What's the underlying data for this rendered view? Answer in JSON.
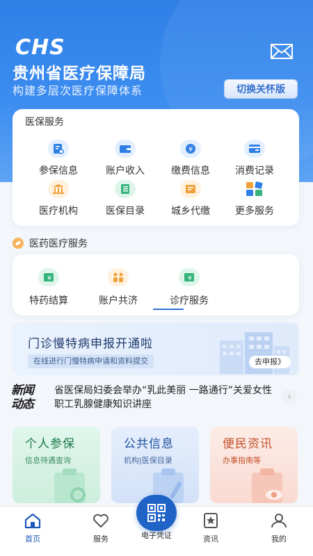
{
  "header": {
    "logo_text": "CHS",
    "org_name": "贵州省医疗保障局",
    "slogan": "构建多层次医疗保障体系",
    "care_mode_button": "切换关怀版",
    "mail_icon": "envelope-icon"
  },
  "services": {
    "title": "医保服务",
    "items": [
      {
        "label": "参保信息",
        "icon": "insurance-doc-icon",
        "color": "#2f7fe6"
      },
      {
        "label": "账户收入",
        "icon": "wallet-icon",
        "color": "#2f7fe6"
      },
      {
        "label": "缴费信息",
        "icon": "yuan-coin-icon",
        "color": "#2f7fe6"
      },
      {
        "label": "消费记录",
        "icon": "card-record-icon",
        "color": "#2f7fe6"
      },
      {
        "label": "医疗机构",
        "icon": "building-icon",
        "color": "#f0a13a"
      },
      {
        "label": "医保目录",
        "icon": "list-doc-icon",
        "color": "#34b37a"
      },
      {
        "label": "城乡代缴",
        "icon": "pay-doc-icon",
        "color": "#f0a13a"
      },
      {
        "label": "更多服务",
        "icon": "grid-apps-icon",
        "color": "#2f7fe6"
      }
    ]
  },
  "medical": {
    "title": "医药医疗服务",
    "items": [
      {
        "label": "特药结算",
        "icon": "yuan-bill-icon"
      },
      {
        "label": "账户共济",
        "icon": "family-share-icon"
      },
      {
        "label": "诊疗服务",
        "icon": "yuan-bill-icon"
      }
    ]
  },
  "banner": {
    "title": "门诊慢特病申报开通啦",
    "subtitle": "在线进行门慢特病申请和资料提交",
    "action": "去申报》"
  },
  "news": {
    "badge_line1": "新闻",
    "badge_line2": "动态",
    "headline": "省医保局妇委会举办“乳此美丽 一路通行”关爱女性职工乳腺健康知识讲座",
    "arrow": "›"
  },
  "tiles": [
    {
      "title": "个人参保",
      "subtitle": "信息待遇查询"
    },
    {
      "title": "公共信息",
      "subtitle": "机构|医保目录"
    },
    {
      "title": "便民资讯",
      "subtitle": "办事指南等"
    }
  ],
  "tabbar": {
    "items": [
      {
        "label": "首页",
        "icon": "home-icon",
        "active": true
      },
      {
        "label": "服务",
        "icon": "heart-icon",
        "active": false
      },
      {
        "label": "电子凭证",
        "icon": "qr-code-icon",
        "active": false
      },
      {
        "label": "资讯",
        "icon": "star-doc-icon",
        "active": false
      },
      {
        "label": "我的",
        "icon": "user-icon",
        "active": false
      }
    ]
  },
  "colors": {
    "primary": "#2f7fe6",
    "tab_active": "#1c57b8"
  }
}
